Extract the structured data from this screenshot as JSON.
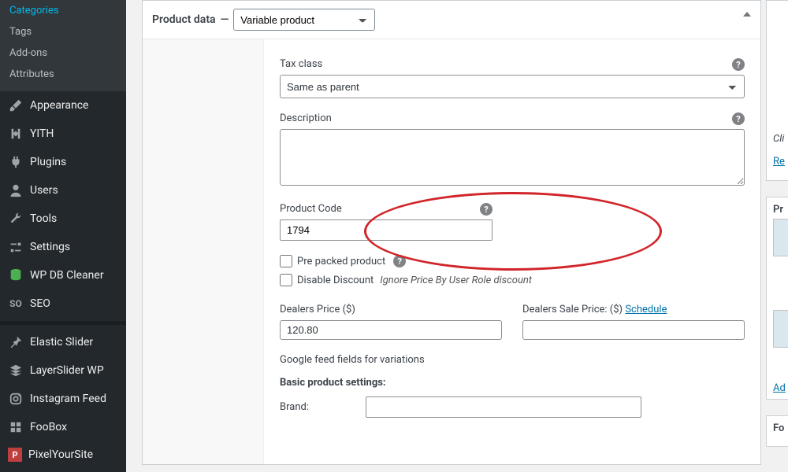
{
  "sidebar": {
    "subitems": [
      "Categories",
      "Tags",
      "Add-ons",
      "Attributes"
    ],
    "items": [
      {
        "icon": "brush",
        "label": "Appearance"
      },
      {
        "icon": "yith",
        "label": "YITH"
      },
      {
        "icon": "plug",
        "label": "Plugins"
      },
      {
        "icon": "user",
        "label": "Users"
      },
      {
        "icon": "wrench",
        "label": "Tools"
      },
      {
        "icon": "sliders",
        "label": "Settings"
      },
      {
        "icon": "db",
        "label": "WP DB Cleaner"
      },
      {
        "icon": "seo",
        "label": "SEO"
      },
      {
        "sep": true
      },
      {
        "icon": "pin",
        "label": "Elastic Slider"
      },
      {
        "icon": "layers",
        "label": "LayerSlider WP"
      },
      {
        "icon": "insta",
        "label": "Instagram Feed"
      },
      {
        "icon": "grid",
        "label": "FooBox"
      },
      {
        "icon": "pys",
        "label": "PixelYourSite"
      }
    ]
  },
  "panel": {
    "title": "Product data",
    "dash": "—",
    "product_type_options": [
      "Variable product"
    ],
    "product_type_selected": "Variable product"
  },
  "fields": {
    "tax_class_label": "Tax class",
    "tax_class_value": "Same as parent",
    "description_label": "Description",
    "description_value": "",
    "product_code_label": "Product Code",
    "product_code_value": "1794",
    "pre_packed_label": "Pre packed product",
    "disable_discount_label": "Disable Discount",
    "disable_discount_hint": "Ignore Price By User Role discount",
    "dealers_price_label": "Dealers Price ($)",
    "dealers_price_value": "120.80",
    "dealers_sale_label": "Dealers Sale Price: ($)",
    "schedule_label": "Schedule",
    "dealers_sale_value": "",
    "google_feed_label": "Google feed fields for variations",
    "basic_settings_label": "Basic product settings:",
    "brand_label": "Brand:",
    "brand_value": ""
  },
  "rightcol": {
    "cli": "Cli",
    "re": "Re",
    "pr": "Pr",
    "ad": "Ad",
    "fo": "Fo"
  }
}
